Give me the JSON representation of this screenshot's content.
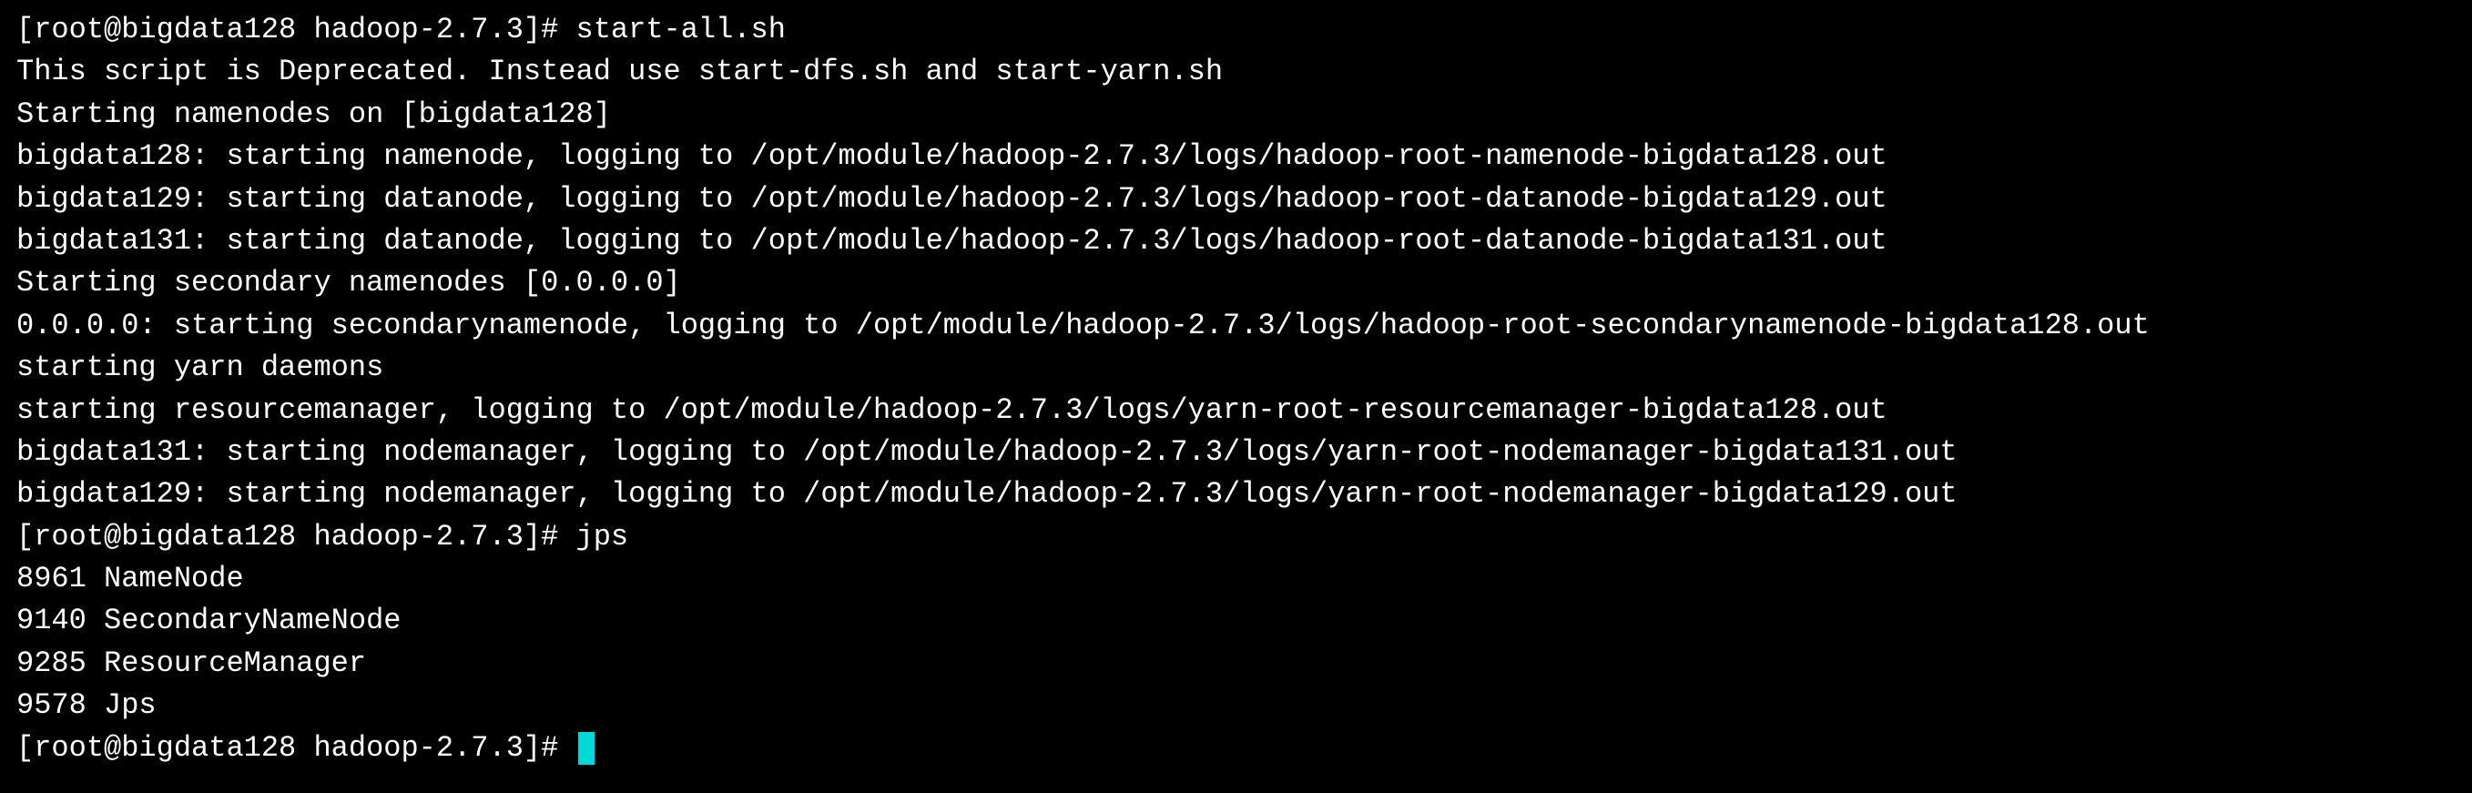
{
  "terminal": {
    "lines": [
      "[root@bigdata128 hadoop-2.7.3]# start-all.sh",
      "This script is Deprecated. Instead use start-dfs.sh and start-yarn.sh",
      "Starting namenodes on [bigdata128]",
      "bigdata128: starting namenode, logging to /opt/module/hadoop-2.7.3/logs/hadoop-root-namenode-bigdata128.out",
      "bigdata129: starting datanode, logging to /opt/module/hadoop-2.7.3/logs/hadoop-root-datanode-bigdata129.out",
      "bigdata131: starting datanode, logging to /opt/module/hadoop-2.7.3/logs/hadoop-root-datanode-bigdata131.out",
      "Starting secondary namenodes [0.0.0.0]",
      "0.0.0.0: starting secondarynamenode, logging to /opt/module/hadoop-2.7.3/logs/hadoop-root-secondarynamenode-bigdata128.out",
      "starting yarn daemons",
      "starting resourcemanager, logging to /opt/module/hadoop-2.7.3/logs/yarn-root-resourcemanager-bigdata128.out",
      "bigdata131: starting nodemanager, logging to /opt/module/hadoop-2.7.3/logs/yarn-root-nodemanager-bigdata131.out",
      "bigdata129: starting nodemanager, logging to /opt/module/hadoop-2.7.3/logs/yarn-root-nodemanager-bigdata129.out",
      "[root@bigdata128 hadoop-2.7.3]# jps",
      "8961 NameNode",
      "9140 SecondaryNameNode",
      "9285 ResourceManager",
      "9578 Jps",
      "[root@bigdata128 hadoop-2.7.3]# "
    ],
    "has_cursor": true
  }
}
